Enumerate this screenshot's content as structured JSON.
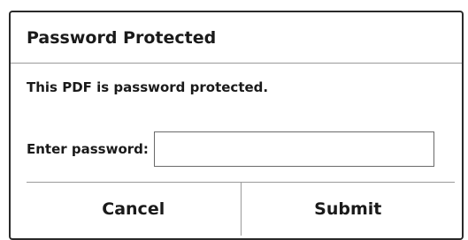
{
  "dialog": {
    "title": "Password Protected",
    "message": "This PDF is password protected.",
    "password_label": "Enter password:",
    "password_value": "",
    "password_placeholder": "",
    "cancel_label": "Cancel",
    "submit_label": "Submit"
  },
  "colors": {
    "border": "#2a2a2a",
    "divider": "#9a9a9a",
    "text": "#1a1a1a",
    "background": "#ffffff"
  }
}
